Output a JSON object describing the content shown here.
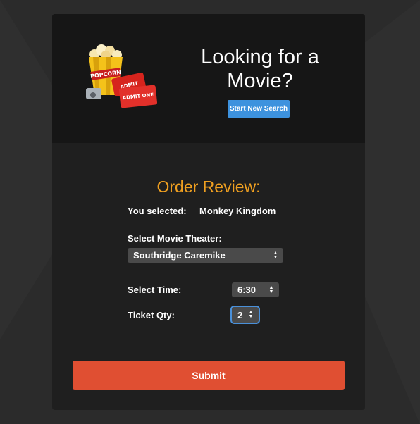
{
  "header": {
    "headline": "Looking for a Movie?",
    "start_button": "Start New Search",
    "logo_text": {
      "popcorn": "POPCORN",
      "ticket1": "ADMIT",
      "ticket2": "ADMIT ONE"
    }
  },
  "order": {
    "title": "Order Review:",
    "selected_label": "You selected:",
    "selected_value": "Monkey Kingdom",
    "theater_label": "Select Movie Theater:",
    "theater_value": "Southridge Caremike",
    "time_label": "Select Time:",
    "time_value": "6:30",
    "qty_label": "Ticket Qty:",
    "qty_value": "2",
    "submit_label": "Submit"
  },
  "colors": {
    "accent": "#f0a020",
    "primary_button": "#3d92de",
    "submit_button": "#e04f32",
    "card_bg": "#1f1f1f",
    "header_bg": "#161616"
  }
}
